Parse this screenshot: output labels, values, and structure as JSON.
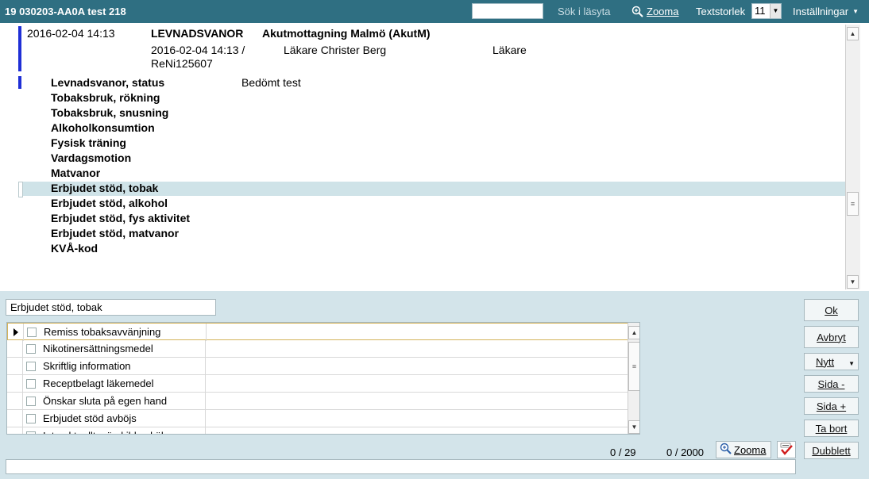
{
  "titlebar": {
    "title": "19 030203-AA0A test 218",
    "search_value": "",
    "search_readonly_label": "Sök i läsyta",
    "zoom_label": "Zooma",
    "textsize_label": "Textstorlek",
    "textsize_value": "11",
    "settings_label": "Inställningar"
  },
  "record": {
    "date": "2016-02-04 14:13",
    "heading": "LEVNADSVANOR",
    "unit": "Akutmottagning Malmö (AkutM)",
    "signed_line1": "2016-02-04 14:13 /",
    "signed_line2": "ReNi125607",
    "author": "Läkare Christer Berg",
    "role": "Läkare",
    "items": [
      {
        "label": "Levnadsvanor, status",
        "value": "Bedömt test"
      },
      {
        "label": "Tobaksbruk, rökning",
        "value": ""
      },
      {
        "label": "Tobaksbruk, snusning",
        "value": ""
      },
      {
        "label": "Alkoholkonsumtion",
        "value": ""
      },
      {
        "label": "Fysisk träning",
        "value": ""
      },
      {
        "label": "Vardagsmotion",
        "value": ""
      },
      {
        "label": "Matvanor",
        "value": ""
      },
      {
        "label": "Erbjudet stöd, tobak",
        "value": ""
      },
      {
        "label": "Erbjudet stöd, alkohol",
        "value": ""
      },
      {
        "label": "Erbjudet stöd, fys aktivitet",
        "value": ""
      },
      {
        "label": "Erbjudet stöd, matvanor",
        "value": ""
      },
      {
        "label": "KVÅ-kod",
        "value": ""
      }
    ],
    "selected_index": 7
  },
  "editor": {
    "field_value": "Erbjudet stöd, tobak",
    "options": [
      "Remiss tobaksavvänjning",
      "Nikotinersättningsmedel",
      "Skriftlig information",
      "Receptbelagt läkemedel",
      "Önskar sluta på egen hand",
      "Erbjudet stöd avböjs",
      "Inte aktuellt, särskilda skäl"
    ],
    "counter_left": "0 / 29",
    "counter_right": "0 / 2000",
    "zoom_label": "Zooma",
    "free_text": ""
  },
  "buttons": {
    "ok": "Ok",
    "cancel": "Avbryt",
    "new": "Nytt",
    "page_prev": "Sida -",
    "page_next": "Sida +",
    "delete": "Ta bort",
    "duplicate": "Dubblett"
  },
  "colors": {
    "titlebar": "#2f6f82",
    "background": "#d3e4ea",
    "record_marker": "#1f2fd6",
    "selected_row": "#cfe3e8"
  }
}
